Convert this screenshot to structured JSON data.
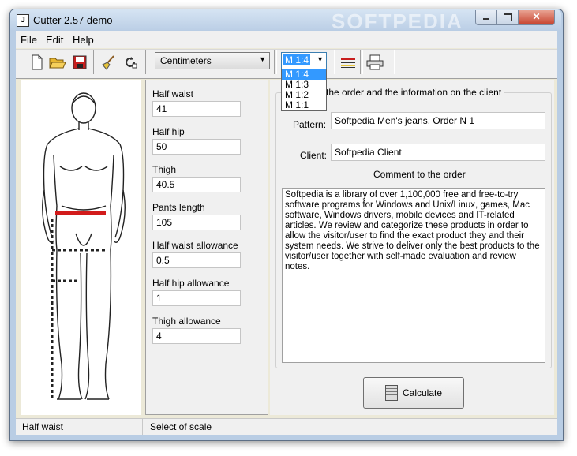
{
  "window": {
    "title": "Cutter 2.57 demo",
    "close_glyph": "✕",
    "watermark": "SOFTPEDIA"
  },
  "menu": [
    {
      "label": "File"
    },
    {
      "label": "Edit"
    },
    {
      "label": "Help"
    }
  ],
  "toolbar": {
    "icons": [
      "new-document-icon",
      "open-folder-icon",
      "save-disk-icon",
      "broom-clear-icon",
      "refresh-icon",
      "pattern-icon",
      "print-icon"
    ],
    "units": {
      "value": "Centimeters"
    },
    "scale": {
      "value": "M 1:4",
      "options": [
        "M 1:4",
        "M 1:3",
        "M 1:2",
        "M 1:1"
      ],
      "highlighted": "M 1:4"
    }
  },
  "measurements": [
    {
      "label": "Half waist",
      "value": "41"
    },
    {
      "label": "Half hip",
      "value": "50"
    },
    {
      "label": "Thigh",
      "value": "40.5"
    },
    {
      "label": "Pants length",
      "value": "105"
    },
    {
      "label": "Half waist allowance",
      "value": "0.5"
    },
    {
      "label": "Half hip allowance",
      "value": "1"
    },
    {
      "label": "Thigh allowance",
      "value": "4"
    }
  ],
  "order": {
    "group_title": "o the order and the information on the client",
    "pattern_label": "Pattern:",
    "pattern_value": "Softpedia Men's jeans. Order N 1",
    "client_label": "Client:",
    "client_value": "Softpedia Client",
    "comment_label": "Comment to the order",
    "comment_text": "Softpedia is a library of over 1,100,000 free and free-to-try software programs for Windows and Unix/Linux, games, Mac software, Windows drivers, mobile devices and IT-related articles. We review and categorize these products in order to allow the visitor/user to find the exact product they and their system needs. We strive to deliver only the best products to the visitor/user together with self-made evaluation and review notes."
  },
  "calculate_label": "Calculate",
  "status": {
    "left": "Half waist",
    "right": "Select of scale"
  },
  "colors": {
    "highlight": "#3399ff",
    "waist_marker": "#d21b1b"
  }
}
